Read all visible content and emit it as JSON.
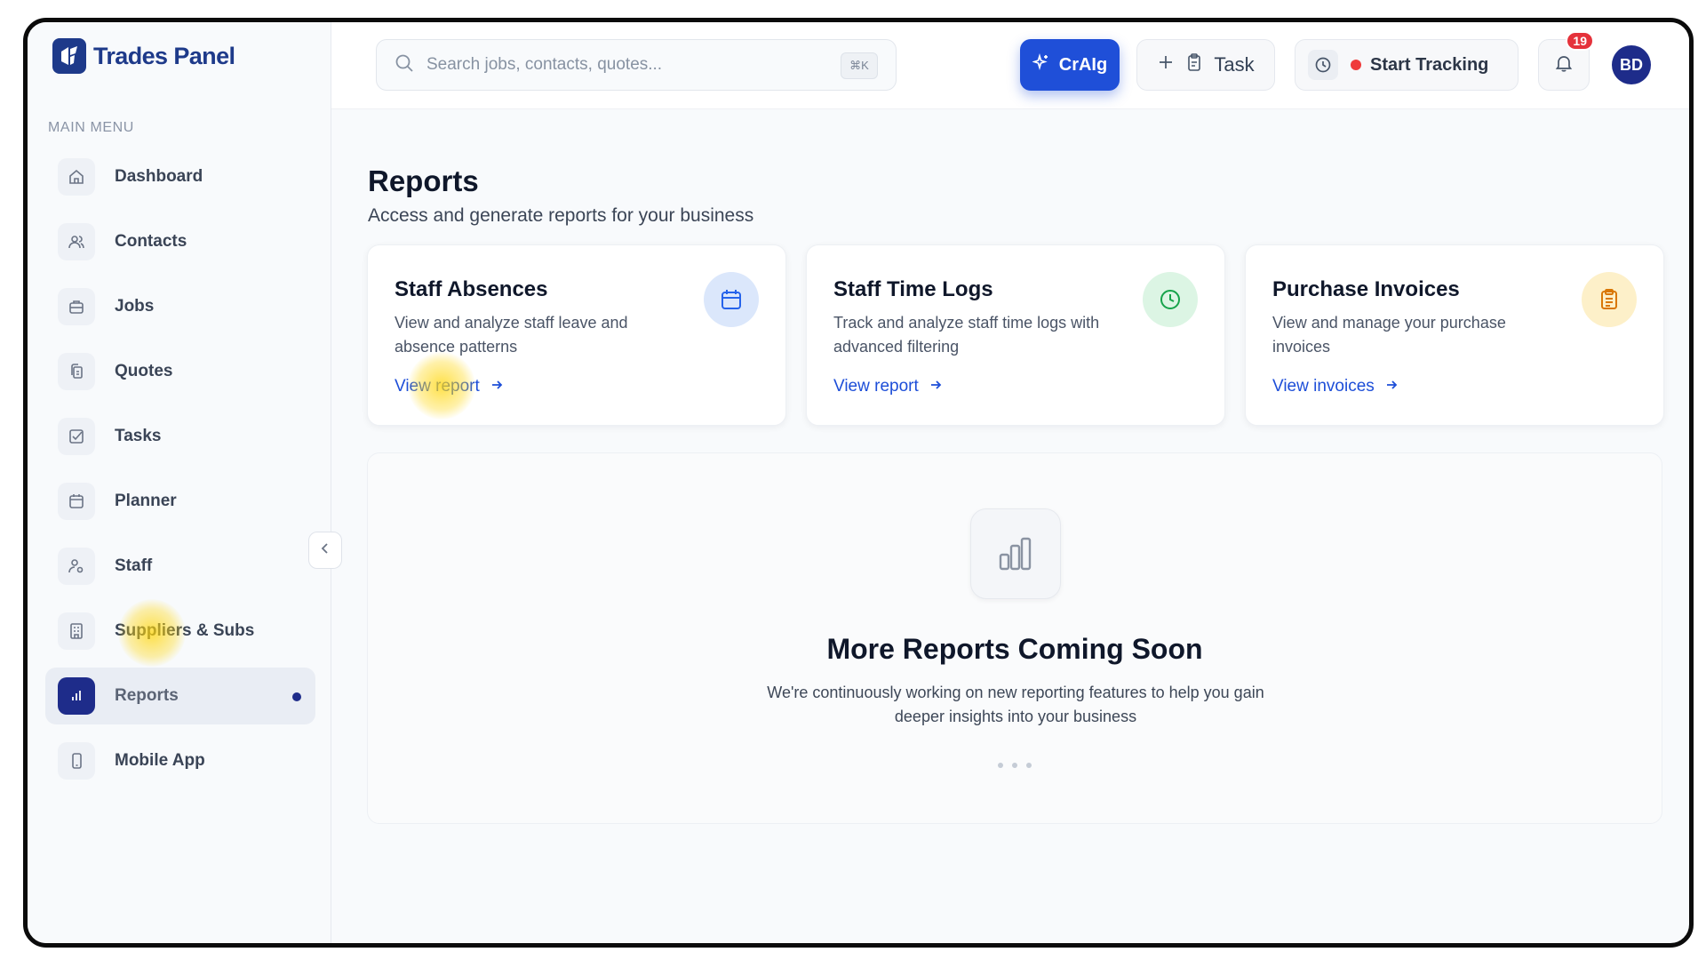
{
  "app": {
    "name": "Trades Panel"
  },
  "sidebar": {
    "heading": "MAIN MENU",
    "items": [
      {
        "label": "Dashboard",
        "icon": "home-icon"
      },
      {
        "label": "Contacts",
        "icon": "users-icon"
      },
      {
        "label": "Jobs",
        "icon": "briefcase-icon"
      },
      {
        "label": "Quotes",
        "icon": "copy-icon"
      },
      {
        "label": "Tasks",
        "icon": "checkbox-icon"
      },
      {
        "label": "Planner",
        "icon": "calendar-icon"
      },
      {
        "label": "Staff",
        "icon": "user-settings-icon"
      },
      {
        "label": "Suppliers & Subs",
        "icon": "building-icon"
      },
      {
        "label": "Reports",
        "icon": "bar-chart-icon",
        "active": true
      },
      {
        "label": "Mobile App",
        "icon": "phone-icon"
      }
    ]
  },
  "topbar": {
    "search_placeholder": "Search jobs, contacts, quotes...",
    "search_shortcut": "⌘K",
    "ai_label": "CrAIg",
    "task_label": "Task",
    "tracking_label": "Start Tracking",
    "notifications_count": "19",
    "avatar_initials": "BD"
  },
  "page": {
    "title": "Reports",
    "subtitle": "Access and generate reports for your business"
  },
  "cards": [
    {
      "title": "Staff Absences",
      "description": "View and analyze staff leave and absence patterns",
      "link": "View report",
      "icon": "calendar-icon",
      "color": "#2563eb"
    },
    {
      "title": "Staff Time Logs",
      "description": "Track and analyze staff time logs with advanced filtering",
      "link": "View report",
      "icon": "clock-icon",
      "color": "#16a34a"
    },
    {
      "title": "Purchase Invoices",
      "description": "View and manage your purchase invoices",
      "link": "View invoices",
      "icon": "clipboard-icon",
      "color": "#d97706"
    }
  ],
  "coming_soon": {
    "title": "More Reports Coming Soon",
    "description": "We're continuously working on new reporting features to help you gain deeper insights into your business"
  },
  "colors": {
    "brand": "#1e3a8a",
    "accent": "#1f4fd8",
    "active_nav": "#1e2c8a",
    "badge": "#e5323b"
  }
}
